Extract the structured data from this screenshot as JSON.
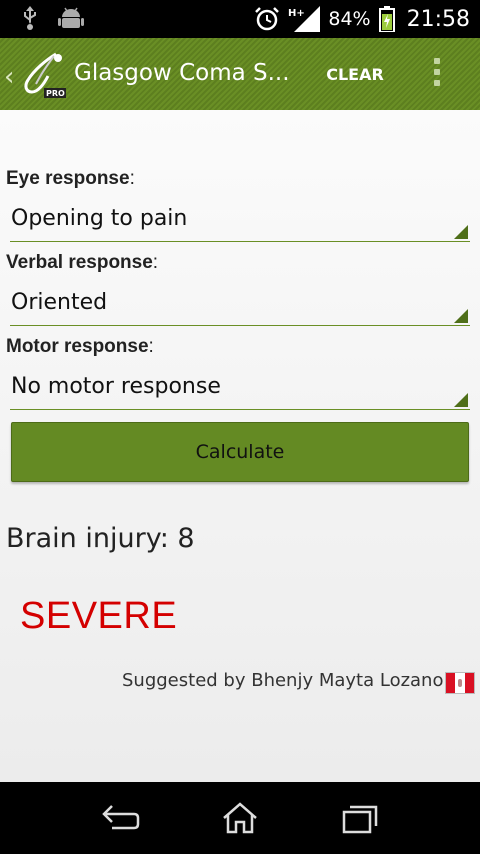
{
  "status_bar": {
    "battery_percent": "84%",
    "time": "21:58",
    "network": "H+",
    "icons": [
      "usb-icon",
      "android-debug-icon",
      "alarm-icon",
      "signal-icon",
      "battery-charging-icon"
    ]
  },
  "action_bar": {
    "title": "Glasgow Coma S...",
    "logo_badge": "PRO",
    "clear_label": "CLEAR"
  },
  "form": {
    "eye": {
      "label": "Eye response",
      "suffix": ":",
      "value": "Opening to pain"
    },
    "verbal": {
      "label": "Verbal response",
      "suffix": ":",
      "value": "Oriented"
    },
    "motor": {
      "label": "Motor response",
      "suffix": ":",
      "value": "No motor response"
    },
    "calculate_label": "Calculate"
  },
  "result": {
    "text": "Brain injury: 8",
    "severity": "SEVERE",
    "severity_color": "#d40000"
  },
  "credit": {
    "text": "Suggested by Bhenjy Mayta Lozano",
    "flag_colors": [
      "#d91023",
      "#ffffff",
      "#d91023"
    ]
  },
  "nav_bar": {
    "icons": [
      "back-icon",
      "home-icon",
      "recent-apps-icon"
    ]
  },
  "theme": {
    "accent": "#648a23",
    "action_bar": "#6a8f25"
  }
}
